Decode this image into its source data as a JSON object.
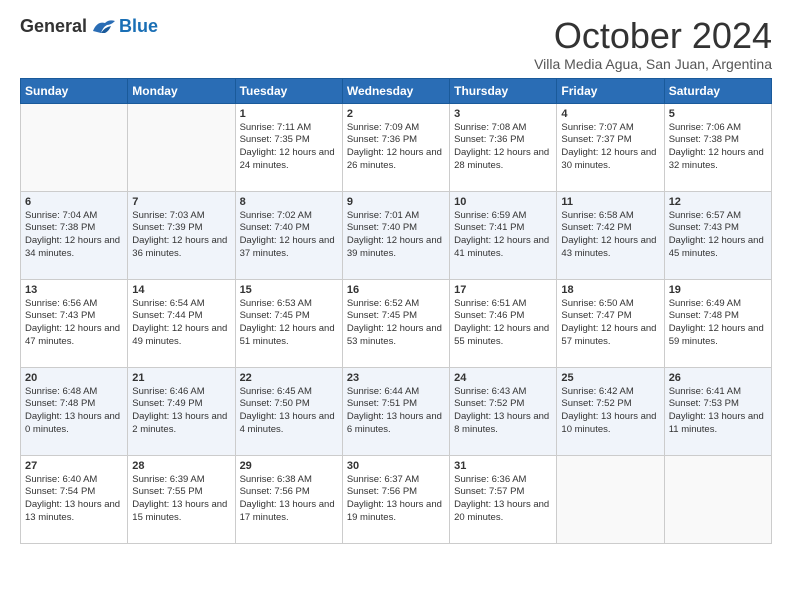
{
  "logo": {
    "general": "General",
    "blue": "Blue"
  },
  "title": "October 2024",
  "subtitle": "Villa Media Agua, San Juan, Argentina",
  "days_of_week": [
    "Sunday",
    "Monday",
    "Tuesday",
    "Wednesday",
    "Thursday",
    "Friday",
    "Saturday"
  ],
  "weeks": [
    [
      {
        "day": "",
        "info": ""
      },
      {
        "day": "",
        "info": ""
      },
      {
        "day": "1",
        "info": "Sunrise: 7:11 AM\nSunset: 7:35 PM\nDaylight: 12 hours and 24 minutes."
      },
      {
        "day": "2",
        "info": "Sunrise: 7:09 AM\nSunset: 7:36 PM\nDaylight: 12 hours and 26 minutes."
      },
      {
        "day": "3",
        "info": "Sunrise: 7:08 AM\nSunset: 7:36 PM\nDaylight: 12 hours and 28 minutes."
      },
      {
        "day": "4",
        "info": "Sunrise: 7:07 AM\nSunset: 7:37 PM\nDaylight: 12 hours and 30 minutes."
      },
      {
        "day": "5",
        "info": "Sunrise: 7:06 AM\nSunset: 7:38 PM\nDaylight: 12 hours and 32 minutes."
      }
    ],
    [
      {
        "day": "6",
        "info": "Sunrise: 7:04 AM\nSunset: 7:38 PM\nDaylight: 12 hours and 34 minutes."
      },
      {
        "day": "7",
        "info": "Sunrise: 7:03 AM\nSunset: 7:39 PM\nDaylight: 12 hours and 36 minutes."
      },
      {
        "day": "8",
        "info": "Sunrise: 7:02 AM\nSunset: 7:40 PM\nDaylight: 12 hours and 37 minutes."
      },
      {
        "day": "9",
        "info": "Sunrise: 7:01 AM\nSunset: 7:40 PM\nDaylight: 12 hours and 39 minutes."
      },
      {
        "day": "10",
        "info": "Sunrise: 6:59 AM\nSunset: 7:41 PM\nDaylight: 12 hours and 41 minutes."
      },
      {
        "day": "11",
        "info": "Sunrise: 6:58 AM\nSunset: 7:42 PM\nDaylight: 12 hours and 43 minutes."
      },
      {
        "day": "12",
        "info": "Sunrise: 6:57 AM\nSunset: 7:43 PM\nDaylight: 12 hours and 45 minutes."
      }
    ],
    [
      {
        "day": "13",
        "info": "Sunrise: 6:56 AM\nSunset: 7:43 PM\nDaylight: 12 hours and 47 minutes."
      },
      {
        "day": "14",
        "info": "Sunrise: 6:54 AM\nSunset: 7:44 PM\nDaylight: 12 hours and 49 minutes."
      },
      {
        "day": "15",
        "info": "Sunrise: 6:53 AM\nSunset: 7:45 PM\nDaylight: 12 hours and 51 minutes."
      },
      {
        "day": "16",
        "info": "Sunrise: 6:52 AM\nSunset: 7:45 PM\nDaylight: 12 hours and 53 minutes."
      },
      {
        "day": "17",
        "info": "Sunrise: 6:51 AM\nSunset: 7:46 PM\nDaylight: 12 hours and 55 minutes."
      },
      {
        "day": "18",
        "info": "Sunrise: 6:50 AM\nSunset: 7:47 PM\nDaylight: 12 hours and 57 minutes."
      },
      {
        "day": "19",
        "info": "Sunrise: 6:49 AM\nSunset: 7:48 PM\nDaylight: 12 hours and 59 minutes."
      }
    ],
    [
      {
        "day": "20",
        "info": "Sunrise: 6:48 AM\nSunset: 7:48 PM\nDaylight: 13 hours and 0 minutes."
      },
      {
        "day": "21",
        "info": "Sunrise: 6:46 AM\nSunset: 7:49 PM\nDaylight: 13 hours and 2 minutes."
      },
      {
        "day": "22",
        "info": "Sunrise: 6:45 AM\nSunset: 7:50 PM\nDaylight: 13 hours and 4 minutes."
      },
      {
        "day": "23",
        "info": "Sunrise: 6:44 AM\nSunset: 7:51 PM\nDaylight: 13 hours and 6 minutes."
      },
      {
        "day": "24",
        "info": "Sunrise: 6:43 AM\nSunset: 7:52 PM\nDaylight: 13 hours and 8 minutes."
      },
      {
        "day": "25",
        "info": "Sunrise: 6:42 AM\nSunset: 7:52 PM\nDaylight: 13 hours and 10 minutes."
      },
      {
        "day": "26",
        "info": "Sunrise: 6:41 AM\nSunset: 7:53 PM\nDaylight: 13 hours and 11 minutes."
      }
    ],
    [
      {
        "day": "27",
        "info": "Sunrise: 6:40 AM\nSunset: 7:54 PM\nDaylight: 13 hours and 13 minutes."
      },
      {
        "day": "28",
        "info": "Sunrise: 6:39 AM\nSunset: 7:55 PM\nDaylight: 13 hours and 15 minutes."
      },
      {
        "day": "29",
        "info": "Sunrise: 6:38 AM\nSunset: 7:56 PM\nDaylight: 13 hours and 17 minutes."
      },
      {
        "day": "30",
        "info": "Sunrise: 6:37 AM\nSunset: 7:56 PM\nDaylight: 13 hours and 19 minutes."
      },
      {
        "day": "31",
        "info": "Sunrise: 6:36 AM\nSunset: 7:57 PM\nDaylight: 13 hours and 20 minutes."
      },
      {
        "day": "",
        "info": ""
      },
      {
        "day": "",
        "info": ""
      }
    ]
  ]
}
